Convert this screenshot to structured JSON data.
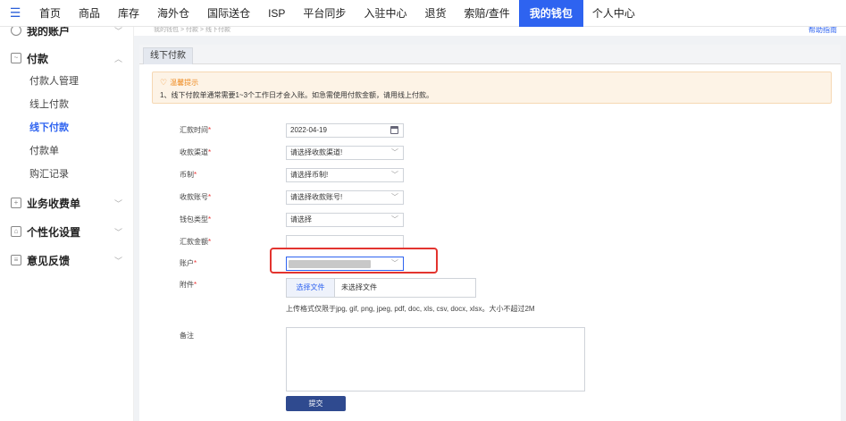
{
  "topnav": {
    "items": [
      "首页",
      "商品",
      "库存",
      "海外仓",
      "国际送仓",
      "ISP",
      "平台同步",
      "入驻中心",
      "退货",
      "索赔/查件",
      "我的钱包",
      "个人中心"
    ],
    "active_index": 10
  },
  "sidebar": {
    "account_group": "我的账户",
    "payment_group": "付款",
    "payment_items": [
      "付款人管理",
      "线上付款",
      "线下付款",
      "付款单",
      "购汇记录"
    ],
    "active_item": "线下付款",
    "other_groups": [
      "业务收费单",
      "个性化设置",
      "意见反馈"
    ]
  },
  "breadcrumb": "我的钱包 > 付款 > 线下付款",
  "help_link": "帮助指南",
  "tab": "线下付款",
  "tip": {
    "title": "温馨提示",
    "text": "1、线下付款单通常需要1~3个工作日才会入账。如急需使用付款金额，请用线上付款。"
  },
  "form": {
    "remit_time": {
      "label": "汇款时间",
      "value": "2022-04-19"
    },
    "channel": {
      "label": "收款渠道",
      "value": "请选择收款渠道!"
    },
    "currency": {
      "label": "币制",
      "value": "请选择币制!"
    },
    "account_no": {
      "label": "收款账号",
      "value": "请选择收款账号!"
    },
    "wallet_type": {
      "label": "钱包类型",
      "value": "请选择"
    },
    "amount": {
      "label": "汇款金额",
      "value": ""
    },
    "account": {
      "label": "账户",
      "value": ""
    },
    "attachment": {
      "label": "附件",
      "button": "选择文件",
      "file": "未选择文件"
    },
    "upload_hint": "上传格式仅限于jpg, gif, png, jpeg, pdf, doc, xls, csv, docx, xlsx。大小不超过2M",
    "remark": {
      "label": "备注",
      "value": ""
    },
    "submit": "提交"
  },
  "colors": {
    "accent": "#2e63f0",
    "highlight": "#e3342f",
    "tip_bg": "#fdf3e6"
  }
}
